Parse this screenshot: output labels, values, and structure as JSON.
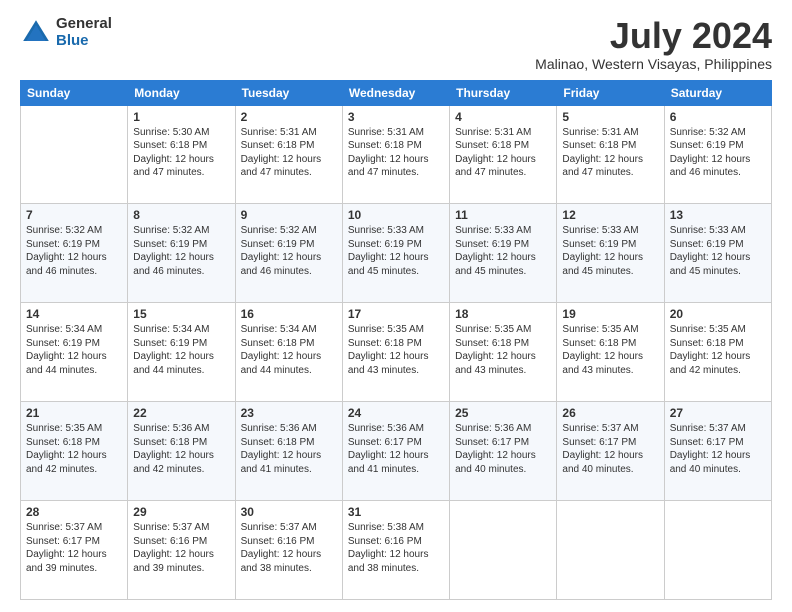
{
  "logo": {
    "general": "General",
    "blue": "Blue"
  },
  "title": "July 2024",
  "subtitle": "Malinao, Western Visayas, Philippines",
  "days_of_week": [
    "Sunday",
    "Monday",
    "Tuesday",
    "Wednesday",
    "Thursday",
    "Friday",
    "Saturday"
  ],
  "weeks": [
    [
      {
        "day": "",
        "info": ""
      },
      {
        "day": "1",
        "info": "Sunrise: 5:30 AM\nSunset: 6:18 PM\nDaylight: 12 hours and 47 minutes."
      },
      {
        "day": "2",
        "info": "Sunrise: 5:31 AM\nSunset: 6:18 PM\nDaylight: 12 hours and 47 minutes."
      },
      {
        "day": "3",
        "info": "Sunrise: 5:31 AM\nSunset: 6:18 PM\nDaylight: 12 hours and 47 minutes."
      },
      {
        "day": "4",
        "info": "Sunrise: 5:31 AM\nSunset: 6:18 PM\nDaylight: 12 hours and 47 minutes."
      },
      {
        "day": "5",
        "info": "Sunrise: 5:31 AM\nSunset: 6:18 PM\nDaylight: 12 hours and 47 minutes."
      },
      {
        "day": "6",
        "info": "Sunrise: 5:32 AM\nSunset: 6:19 PM\nDaylight: 12 hours and 46 minutes."
      }
    ],
    [
      {
        "day": "7",
        "info": "Sunrise: 5:32 AM\nSunset: 6:19 PM\nDaylight: 12 hours and 46 minutes."
      },
      {
        "day": "8",
        "info": "Sunrise: 5:32 AM\nSunset: 6:19 PM\nDaylight: 12 hours and 46 minutes."
      },
      {
        "day": "9",
        "info": "Sunrise: 5:32 AM\nSunset: 6:19 PM\nDaylight: 12 hours and 46 minutes."
      },
      {
        "day": "10",
        "info": "Sunrise: 5:33 AM\nSunset: 6:19 PM\nDaylight: 12 hours and 45 minutes."
      },
      {
        "day": "11",
        "info": "Sunrise: 5:33 AM\nSunset: 6:19 PM\nDaylight: 12 hours and 45 minutes."
      },
      {
        "day": "12",
        "info": "Sunrise: 5:33 AM\nSunset: 6:19 PM\nDaylight: 12 hours and 45 minutes."
      },
      {
        "day": "13",
        "info": "Sunrise: 5:33 AM\nSunset: 6:19 PM\nDaylight: 12 hours and 45 minutes."
      }
    ],
    [
      {
        "day": "14",
        "info": "Sunrise: 5:34 AM\nSunset: 6:19 PM\nDaylight: 12 hours and 44 minutes."
      },
      {
        "day": "15",
        "info": "Sunrise: 5:34 AM\nSunset: 6:19 PM\nDaylight: 12 hours and 44 minutes."
      },
      {
        "day": "16",
        "info": "Sunrise: 5:34 AM\nSunset: 6:18 PM\nDaylight: 12 hours and 44 minutes."
      },
      {
        "day": "17",
        "info": "Sunrise: 5:35 AM\nSunset: 6:18 PM\nDaylight: 12 hours and 43 minutes."
      },
      {
        "day": "18",
        "info": "Sunrise: 5:35 AM\nSunset: 6:18 PM\nDaylight: 12 hours and 43 minutes."
      },
      {
        "day": "19",
        "info": "Sunrise: 5:35 AM\nSunset: 6:18 PM\nDaylight: 12 hours and 43 minutes."
      },
      {
        "day": "20",
        "info": "Sunrise: 5:35 AM\nSunset: 6:18 PM\nDaylight: 12 hours and 42 minutes."
      }
    ],
    [
      {
        "day": "21",
        "info": "Sunrise: 5:35 AM\nSunset: 6:18 PM\nDaylight: 12 hours and 42 minutes."
      },
      {
        "day": "22",
        "info": "Sunrise: 5:36 AM\nSunset: 6:18 PM\nDaylight: 12 hours and 42 minutes."
      },
      {
        "day": "23",
        "info": "Sunrise: 5:36 AM\nSunset: 6:18 PM\nDaylight: 12 hours and 41 minutes."
      },
      {
        "day": "24",
        "info": "Sunrise: 5:36 AM\nSunset: 6:17 PM\nDaylight: 12 hours and 41 minutes."
      },
      {
        "day": "25",
        "info": "Sunrise: 5:36 AM\nSunset: 6:17 PM\nDaylight: 12 hours and 40 minutes."
      },
      {
        "day": "26",
        "info": "Sunrise: 5:37 AM\nSunset: 6:17 PM\nDaylight: 12 hours and 40 minutes."
      },
      {
        "day": "27",
        "info": "Sunrise: 5:37 AM\nSunset: 6:17 PM\nDaylight: 12 hours and 40 minutes."
      }
    ],
    [
      {
        "day": "28",
        "info": "Sunrise: 5:37 AM\nSunset: 6:17 PM\nDaylight: 12 hours and 39 minutes."
      },
      {
        "day": "29",
        "info": "Sunrise: 5:37 AM\nSunset: 6:16 PM\nDaylight: 12 hours and 39 minutes."
      },
      {
        "day": "30",
        "info": "Sunrise: 5:37 AM\nSunset: 6:16 PM\nDaylight: 12 hours and 38 minutes."
      },
      {
        "day": "31",
        "info": "Sunrise: 5:38 AM\nSunset: 6:16 PM\nDaylight: 12 hours and 38 minutes."
      },
      {
        "day": "",
        "info": ""
      },
      {
        "day": "",
        "info": ""
      },
      {
        "day": "",
        "info": ""
      }
    ]
  ]
}
